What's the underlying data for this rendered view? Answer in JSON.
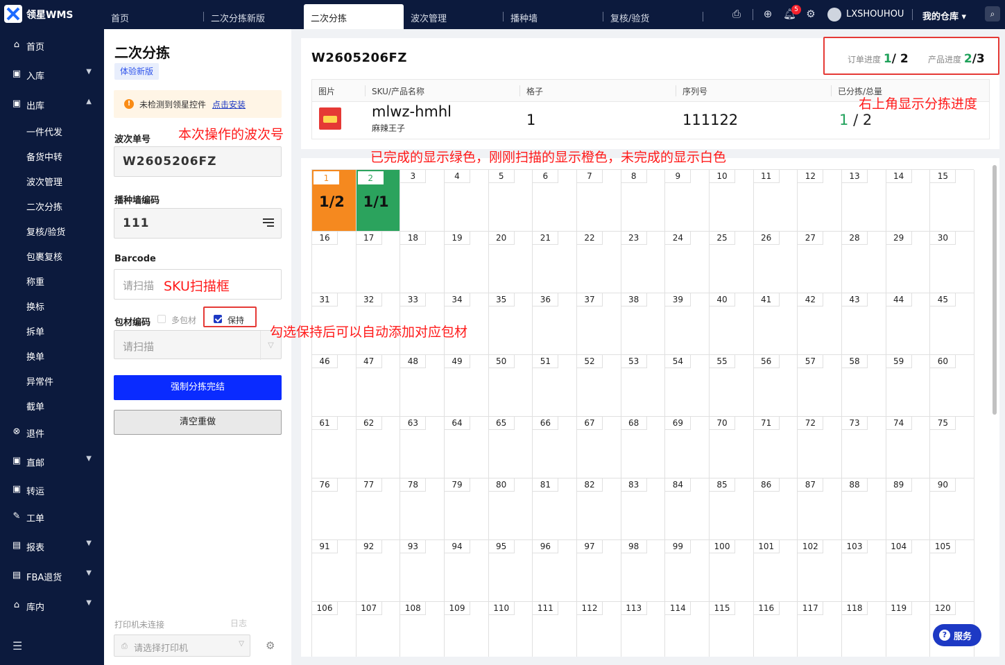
{
  "app": {
    "logo_text": "领星WMS"
  },
  "tabs": [
    {
      "label": "首页"
    },
    {
      "label": "二次分拣新版"
    },
    {
      "label": "二次分拣"
    },
    {
      "label": "波次管理"
    },
    {
      "label": "播种墙"
    },
    {
      "label": "复核/验货"
    }
  ],
  "header": {
    "notification_count": "5",
    "username": "LXSHOUHOU",
    "warehouse": "我的仓库 ▾"
  },
  "sidebar": {
    "items": [
      {
        "label": "首页",
        "icon": "home-icon"
      },
      {
        "label": "入库",
        "icon": "inbound-icon"
      },
      {
        "label": "出库",
        "icon": "outbound-icon"
      },
      {
        "label": "退件",
        "icon": "return-icon"
      },
      {
        "label": "直邮",
        "icon": "direct-mail-icon"
      },
      {
        "label": "转运",
        "icon": "transfer-icon"
      },
      {
        "label": "工单",
        "icon": "work-order-icon"
      },
      {
        "label": "报表",
        "icon": "report-icon"
      },
      {
        "label": "FBA退货",
        "icon": "fba-return-icon"
      },
      {
        "label": "库内",
        "icon": "warehouse-icon"
      }
    ],
    "sub_items": [
      {
        "label": "一件代发"
      },
      {
        "label": "备货中转"
      },
      {
        "label": "波次管理"
      },
      {
        "label": "二次分拣"
      },
      {
        "label": "复核/验货"
      },
      {
        "label": "包裹复核"
      },
      {
        "label": "称重"
      },
      {
        "label": "换标"
      },
      {
        "label": "拆单"
      },
      {
        "label": "换单"
      },
      {
        "label": "异常件"
      },
      {
        "label": "截单"
      }
    ]
  },
  "left_panel": {
    "title": "二次分拣",
    "tag": "体验新版",
    "warning_text": "未检测到领星控件",
    "warning_link": "点击安装",
    "wave_label": "波次单号",
    "wave_value": "W2605206FZ",
    "wall_label": "播种墙编码",
    "wall_value": "111",
    "barcode_label": "Barcode",
    "barcode_placeholder": "请扫描",
    "packaging_label": "包材编码",
    "multi_pack_label": "多包材",
    "keep_label": "保持",
    "packaging_placeholder": "请扫描",
    "force_button": "强制分拣完结",
    "reset_button": "清空重做",
    "printer_status": "打印机未连接",
    "log_link": "日志",
    "printer_placeholder": "请选择打印机"
  },
  "main": {
    "wave_title": "W2605206FZ",
    "order_progress_label": "订单进度",
    "order_progress_done": "1",
    "order_progress_total": "/ 2",
    "product_progress_label": "产品进度",
    "product_progress_done": "2",
    "product_progress_total": "/3",
    "table_headers": [
      "图片",
      "SKU/产品名称",
      "格子",
      "序列号",
      "已分拣/总量"
    ],
    "row": {
      "sku": "mlwz-hmhl",
      "name": "麻辣王子",
      "cell": "1",
      "serial": "111122",
      "sorted": "1",
      "total": "/ 2"
    },
    "grid": {
      "columns": 15,
      "rows": 8,
      "filled": [
        {
          "slot": 1,
          "value": "1/2",
          "status": "scanned",
          "color": "#f5891f"
        },
        {
          "slot": 2,
          "value": "1/1",
          "status": "completed",
          "color": "#2ba35d"
        }
      ]
    }
  },
  "service_button": "服务",
  "annotations": {
    "wave_note": "本次操作的波次号",
    "sku_note": "SKU扫描框",
    "keep_note": "勾选保持后可以自动添加对应包材",
    "color_note": "已完成的显示绿色，刚刚扫描的显示橙色，未完成的显示白色",
    "progress_note": "右上角显示分拣进度"
  }
}
